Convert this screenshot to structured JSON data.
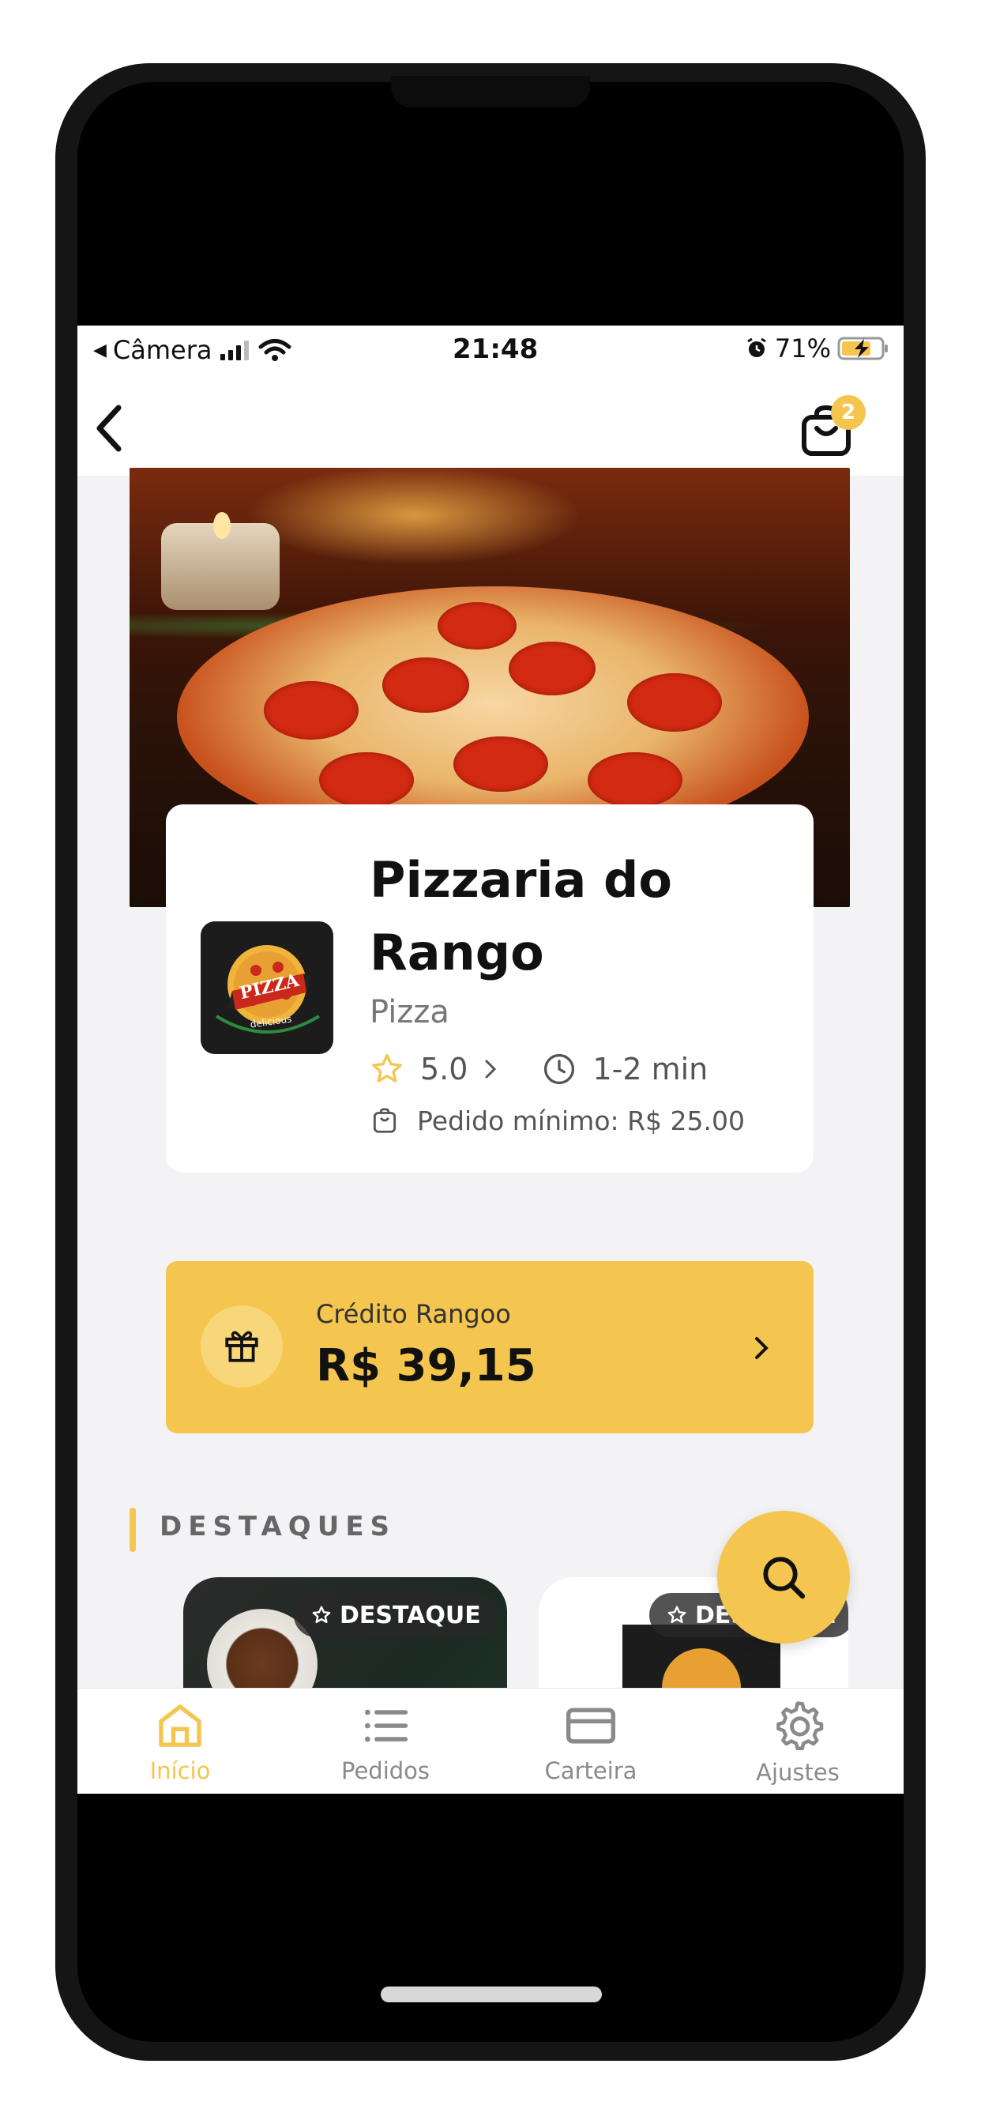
{
  "status": {
    "back_app": "Câmera",
    "time": "21:48",
    "battery": "71%"
  },
  "nav": {
    "cart_count": "2"
  },
  "restaurant": {
    "name": "Pizzaria do Rango",
    "category": "Pizza",
    "rating": "5.0",
    "delivery_time": "1-2 min",
    "min_order": "Pedido mínimo: R$ 25.00",
    "logo_text": "PIZZA",
    "logo_subtext": "delicious"
  },
  "credit": {
    "label": "Crédito Rangoo",
    "value": "R$ 39,15"
  },
  "highlights": {
    "title": "DESTAQUES",
    "items": [
      {
        "badge": "DESTAQUE"
      },
      {
        "badge": "DESTAQUE"
      }
    ]
  },
  "tabs": [
    {
      "label": "Início",
      "icon": "home-icon",
      "active": true
    },
    {
      "label": "Pedidos",
      "icon": "list-icon",
      "active": false
    },
    {
      "label": "Carteira",
      "icon": "card-icon",
      "active": false
    },
    {
      "label": "Ajustes",
      "icon": "gear-icon",
      "active": false
    }
  ],
  "colors": {
    "accent": "#f5c64f",
    "background": "#f3f3f5"
  }
}
